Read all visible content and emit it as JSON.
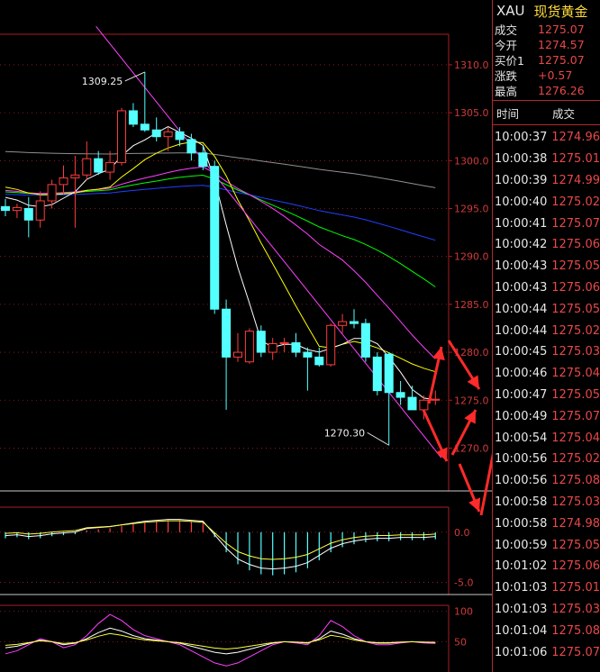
{
  "header": {
    "symbol": "XAU",
    "name": "现货黄金"
  },
  "quotes": [
    {
      "label": "成交",
      "value": "1275.07"
    },
    {
      "label": "今开",
      "value": "1274.57"
    },
    {
      "label": "买价1",
      "value": "1275.07"
    },
    {
      "label": "涨跌",
      "value": "+0.57"
    },
    {
      "label": "最高",
      "value": "1276.26"
    }
  ],
  "ticks_header": {
    "time": "时间",
    "price": "成交"
  },
  "ticks": [
    {
      "time": "10:00:37",
      "price": "1274.96"
    },
    {
      "time": "10:00:38",
      "price": "1275.01"
    },
    {
      "time": "10:00:39",
      "price": "1274.99"
    },
    {
      "time": "10:00:40",
      "price": "1275.02"
    },
    {
      "time": "10:00:41",
      "price": "1275.07"
    },
    {
      "time": "10:00:42",
      "price": "1275.06"
    },
    {
      "time": "10:00:43",
      "price": "1275.05"
    },
    {
      "time": "10:00:43",
      "price": "1275.06"
    },
    {
      "time": "10:00:44",
      "price": "1275.05"
    },
    {
      "time": "10:00:44",
      "price": "1275.02"
    },
    {
      "time": "10:00:45",
      "price": "1275.03"
    },
    {
      "time": "10:00:46",
      "price": "1275.04"
    },
    {
      "time": "10:00:47",
      "price": "1275.05"
    },
    {
      "time": "10:00:49",
      "price": "1275.07"
    },
    {
      "time": "10:00:54",
      "price": "1275.04"
    },
    {
      "time": "10:00:56",
      "price": "1275.02"
    },
    {
      "time": "10:00:56",
      "price": "1275.08"
    },
    {
      "time": "10:00:58",
      "price": "1275.03"
    },
    {
      "time": "10:00:58",
      "price": "1274.98"
    },
    {
      "time": "10:00:59",
      "price": "1275.05"
    },
    {
      "time": "10:01:02",
      "price": "1275.06"
    },
    {
      "time": "10:01:03",
      "price": "1275.01"
    },
    {
      "time": "10:01:03",
      "price": "1275.03"
    },
    {
      "time": "10:01:04",
      "price": "1275.08"
    },
    {
      "time": "10:01:06",
      "price": "1275.07"
    }
  ],
  "chart_data": [
    {
      "type": "candlestick",
      "y_ticks": [
        "1310.0",
        "1305.0",
        "1300.0",
        "1295.0",
        "1290.0",
        "1285.0",
        "1280.0",
        "1275.0",
        "1270.0"
      ],
      "ylim": [
        1266,
        1313
      ],
      "annotations": [
        {
          "text": "1309.25",
          "value": 1309.25,
          "index": 12
        },
        {
          "text": "1270.30",
          "value": 1270.3,
          "index": 33
        }
      ],
      "colors": {
        "up": "#ff3c3c",
        "down": "#54ffff",
        "ma5": "#ffffff",
        "ma10": "#ffff00",
        "ma20": "#ff40ff",
        "ma30": "#00ff00",
        "ma60": "#2040ff",
        "ma120": "#909090",
        "trend": "#ff40ff"
      },
      "candles": [
        {
          "o": 1295.2,
          "h": 1296.0,
          "l": 1294.2,
          "c": 1294.8
        },
        {
          "o": 1294.8,
          "h": 1295.5,
          "l": 1294.0,
          "c": 1295.1
        },
        {
          "o": 1295.0,
          "h": 1296.2,
          "l": 1292.0,
          "c": 1293.8
        },
        {
          "o": 1293.8,
          "h": 1296.8,
          "l": 1293.0,
          "c": 1295.8
        },
        {
          "o": 1295.8,
          "h": 1298.0,
          "l": 1295.0,
          "c": 1297.5
        },
        {
          "o": 1297.5,
          "h": 1299.5,
          "l": 1296.5,
          "c": 1298.2
        },
        {
          "o": 1298.2,
          "h": 1300.5,
          "l": 1293.0,
          "c": 1298.5
        },
        {
          "o": 1298.5,
          "h": 1302.0,
          "l": 1298.0,
          "c": 1300.2
        },
        {
          "o": 1300.2,
          "h": 1301.0,
          "l": 1298.5,
          "c": 1298.8
        },
        {
          "o": 1298.8,
          "h": 1301.0,
          "l": 1298.0,
          "c": 1299.8
        },
        {
          "o": 1299.8,
          "h": 1305.5,
          "l": 1299.5,
          "c": 1305.2
        },
        {
          "o": 1305.2,
          "h": 1306.0,
          "l": 1303.5,
          "c": 1303.8
        },
        {
          "o": 1303.8,
          "h": 1309.25,
          "l": 1303.0,
          "c": 1303.2
        },
        {
          "o": 1303.2,
          "h": 1304.5,
          "l": 1302.0,
          "c": 1302.5
        },
        {
          "o": 1302.5,
          "h": 1303.5,
          "l": 1301.0,
          "c": 1303.0
        },
        {
          "o": 1303.0,
          "h": 1303.5,
          "l": 1301.5,
          "c": 1302.2
        },
        {
          "o": 1302.2,
          "h": 1302.8,
          "l": 1300.0,
          "c": 1300.8
        },
        {
          "o": 1300.8,
          "h": 1301.5,
          "l": 1299.0,
          "c": 1299.4
        },
        {
          "o": 1299.4,
          "h": 1300.0,
          "l": 1284.0,
          "c": 1284.5
        },
        {
          "o": 1284.5,
          "h": 1285.5,
          "l": 1274.0,
          "c": 1279.5
        },
        {
          "o": 1279.5,
          "h": 1282.0,
          "l": 1279.0,
          "c": 1280.0
        },
        {
          "o": 1279.0,
          "h": 1282.5,
          "l": 1278.8,
          "c": 1282.2
        },
        {
          "o": 1282.2,
          "h": 1282.8,
          "l": 1279.5,
          "c": 1280.0
        },
        {
          "o": 1280.0,
          "h": 1281.5,
          "l": 1279.2,
          "c": 1280.9
        },
        {
          "o": 1280.9,
          "h": 1281.5,
          "l": 1280.0,
          "c": 1281.0
        },
        {
          "o": 1281.0,
          "h": 1282.0,
          "l": 1279.5,
          "c": 1280.0
        },
        {
          "o": 1280.0,
          "h": 1280.5,
          "l": 1276.0,
          "c": 1279.5
        },
        {
          "o": 1279.5,
          "h": 1280.5,
          "l": 1278.5,
          "c": 1278.7
        },
        {
          "o": 1278.7,
          "h": 1283.0,
          "l": 1278.5,
          "c": 1282.8
        },
        {
          "o": 1282.8,
          "h": 1284.0,
          "l": 1282.0,
          "c": 1283.2
        },
        {
          "o": 1283.2,
          "h": 1284.5,
          "l": 1282.5,
          "c": 1283.0
        },
        {
          "o": 1283.0,
          "h": 1283.5,
          "l": 1279.0,
          "c": 1279.5
        },
        {
          "o": 1279.5,
          "h": 1280.0,
          "l": 1275.5,
          "c": 1276.0
        },
        {
          "o": 1279.8,
          "h": 1280.0,
          "l": 1270.3,
          "c": 1275.8
        },
        {
          "o": 1275.8,
          "h": 1277.0,
          "l": 1274.5,
          "c": 1275.3
        },
        {
          "o": 1275.3,
          "h": 1276.5,
          "l": 1274.0,
          "c": 1274.0
        },
        {
          "o": 1274.0,
          "h": 1275.5,
          "l": 1273.0,
          "c": 1275.0
        },
        {
          "o": 1275.0,
          "h": 1276.0,
          "l": 1274.5,
          "c": 1275.1
        }
      ]
    },
    {
      "type": "macd",
      "y_ticks": [
        "0.0",
        "-5.0"
      ],
      "ylim": [
        -5.5,
        2.5
      ],
      "histogram": [
        -0.6,
        -0.5,
        -0.7,
        -0.6,
        -0.4,
        -0.3,
        -0.2,
        0.2,
        0.3,
        0.4,
        0.6,
        0.8,
        1.0,
        1.1,
        1.2,
        1.2,
        1.1,
        1.0,
        -0.5,
        -2.0,
        -3.2,
        -3.8,
        -4.2,
        -4.3,
        -4.2,
        -4.0,
        -3.6,
        -2.8,
        -2.0,
        -1.5,
        -1.2,
        -1.0,
        -0.9,
        -0.9,
        -0.8,
        -0.8,
        -0.8,
        -0.7
      ]
    },
    {
      "type": "kdj",
      "y_ticks": [
        "100",
        "50"
      ],
      "ylim": [
        0,
        110
      ]
    }
  ]
}
